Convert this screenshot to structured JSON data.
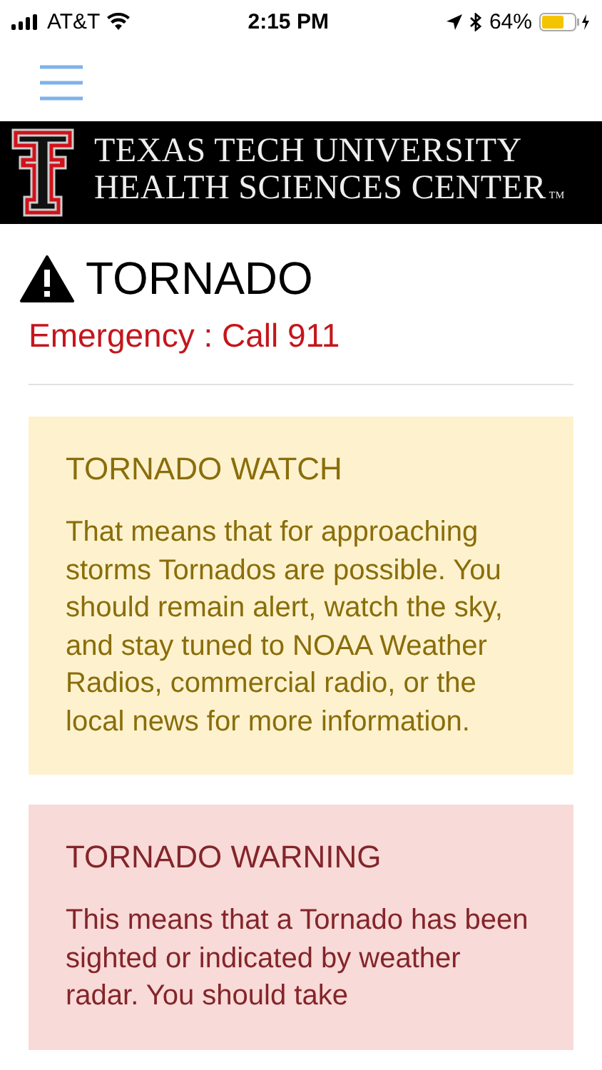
{
  "status_bar": {
    "carrier": "AT&T",
    "time": "2:15 PM",
    "battery": "64%"
  },
  "banner": {
    "line_1": "TEXAS TECH UNIVERSITY",
    "line_2": "HEALTH SCIENCES CENTER",
    "trademark": "TM"
  },
  "title": "TORNADO",
  "emergency": "Emergency : Call 911",
  "cards": [
    {
      "kind": "watch",
      "heading": "TORNADO WATCH",
      "body": "That means that for approaching storms Tornados are possible. You should remain alert, watch the sky, and stay tuned to NOAA Weather Radios, commercial radio, or the local news for more information."
    },
    {
      "kind": "warning",
      "heading": "TORNADO WARNING",
      "body": "This means that a Tornado has been sighted or indicated by weather radar. You should take"
    }
  ]
}
